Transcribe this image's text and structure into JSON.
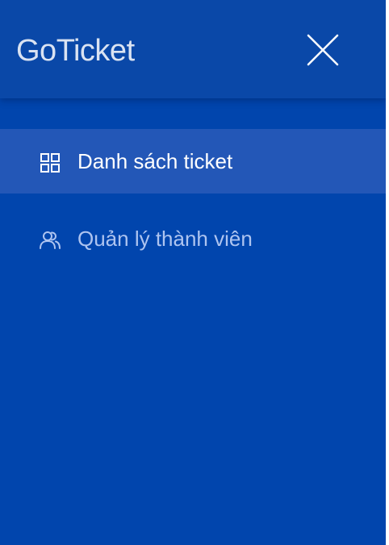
{
  "app": {
    "brand": "GoTicket"
  },
  "header": {
    "close_icon": "close-icon"
  },
  "menu": {
    "items": [
      {
        "label": "Danh sách ticket",
        "icon": "grid-icon",
        "active": true
      },
      {
        "label": "Quản lý thành viên",
        "icon": "users-icon",
        "active": false
      }
    ]
  },
  "colors": {
    "drawer_bg": "#0145ad",
    "header_bg": "#0a48a8",
    "active_item_bg": "#2357b7",
    "active_text": "#ffffff",
    "inactive_text": "#aec4f0"
  }
}
